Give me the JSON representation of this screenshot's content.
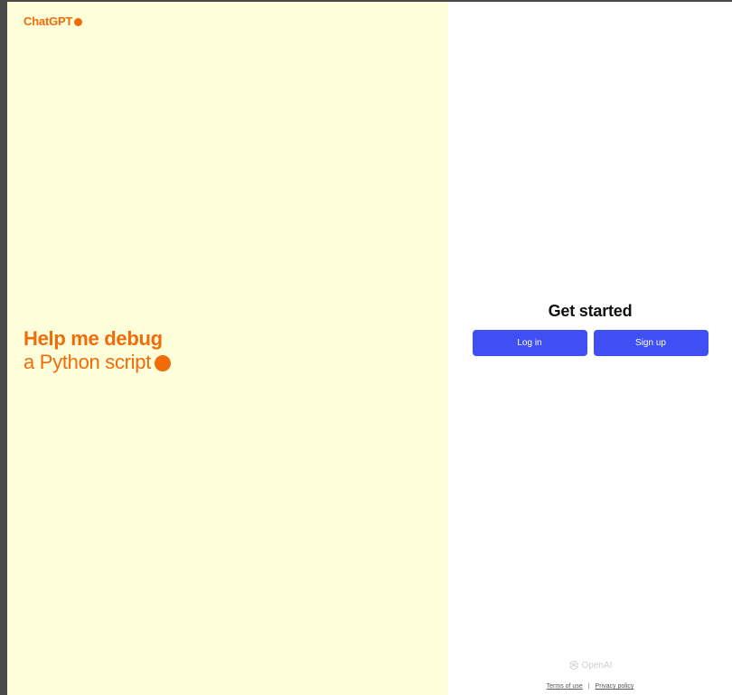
{
  "brand": {
    "name": "ChatGPT",
    "accent_color": "#f26b09"
  },
  "hero": {
    "line1": "Help me debug",
    "line2": "a Python script"
  },
  "auth": {
    "title": "Get started",
    "login_label": "Log in",
    "signup_label": "Sign up",
    "button_color": "#3f4ff4"
  },
  "footer": {
    "logo_text": "OpenAI",
    "logo_icon": "openai-icon",
    "terms_label": "Terms of use",
    "separator": "|",
    "privacy_label": "Privacy policy"
  },
  "colors": {
    "left_panel_bg": "#fefedb",
    "right_panel_bg": "#ffffff"
  }
}
